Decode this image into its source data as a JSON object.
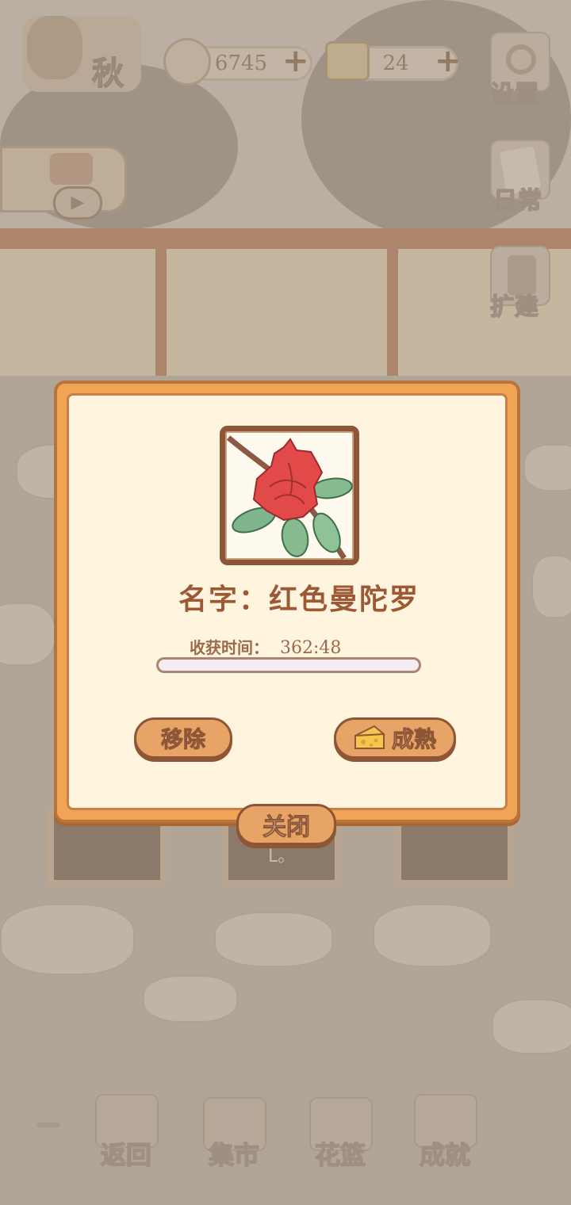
{
  "hud": {
    "season": "秋",
    "fish_count": "6745",
    "cheese_count": "24"
  },
  "side_menu": {
    "settings": "设置",
    "daily": "日常",
    "expand": "扩建"
  },
  "bottom_nav": {
    "back": "返回",
    "market": "集市",
    "basket": "花篮",
    "achievements": "成就"
  },
  "plot_label": "L。",
  "dialog": {
    "flower_name": "名字：红色曼陀罗",
    "harvest_label": "收获时间：",
    "harvest_time": "362:48",
    "progress": 0.0,
    "remove_label": "移除",
    "ripen_label": "成熟",
    "close_label": "关闭"
  },
  "colors": {
    "dialog_border": "#f1a356",
    "dialog_bg": "#fff5de",
    "button": "#e8a466",
    "text_brown": "#9b5a35"
  }
}
